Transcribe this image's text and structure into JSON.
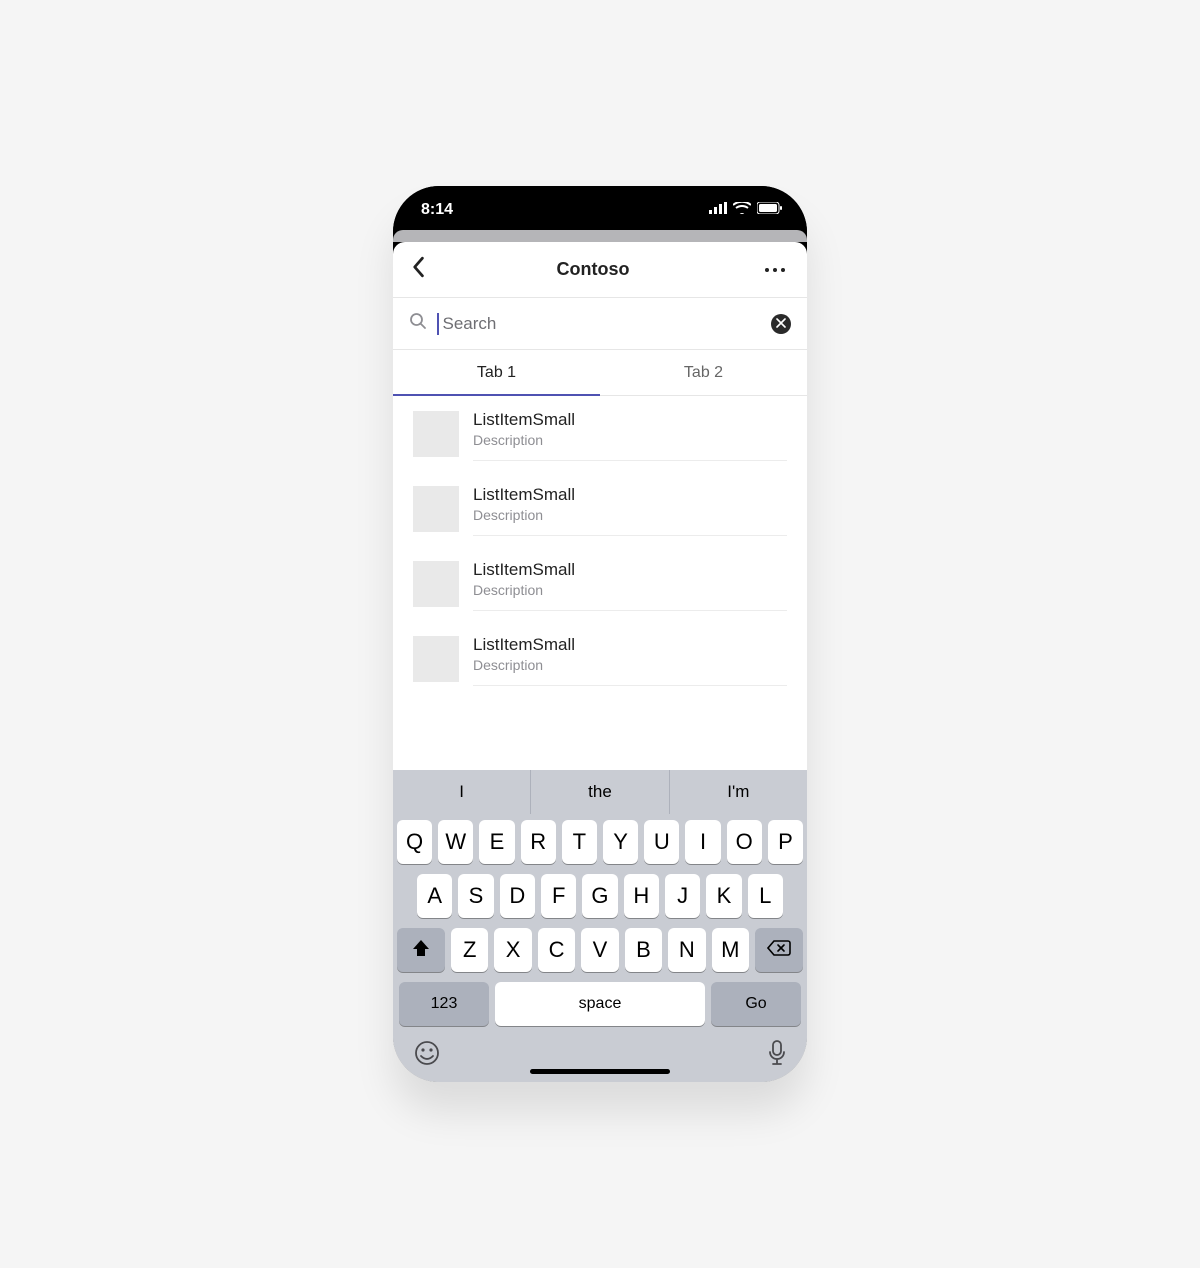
{
  "status": {
    "time": "8:14"
  },
  "header": {
    "title": "Contoso"
  },
  "search": {
    "placeholder": "Search",
    "value": ""
  },
  "tabs": [
    {
      "label": "Tab 1",
      "active": true
    },
    {
      "label": "Tab 2",
      "active": false
    }
  ],
  "list": [
    {
      "title": "ListItemSmall",
      "description": "Description"
    },
    {
      "title": "ListItemSmall",
      "description": "Description"
    },
    {
      "title": "ListItemSmall",
      "description": "Description"
    },
    {
      "title": "ListItemSmall",
      "description": "Description"
    }
  ],
  "keyboard": {
    "suggestions": [
      "I",
      "the",
      "I'm"
    ],
    "rows": [
      [
        "Q",
        "W",
        "E",
        "R",
        "T",
        "Y",
        "U",
        "I",
        "O",
        "P"
      ],
      [
        "A",
        "S",
        "D",
        "F",
        "G",
        "H",
        "J",
        "K",
        "L"
      ],
      [
        "Z",
        "X",
        "C",
        "V",
        "B",
        "N",
        "M"
      ]
    ],
    "fn_label": "123",
    "space_label": "space",
    "go_label": "Go"
  }
}
